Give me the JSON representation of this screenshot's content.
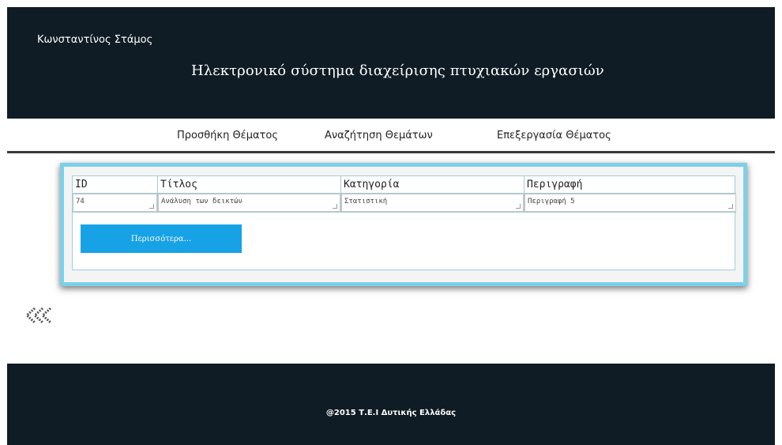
{
  "header": {
    "user_name": "Κωνσταντίνος Στάμος",
    "title": "Ηλεκτρονικό σύστημα διαχείρισης πτυχιακών εργασιών"
  },
  "nav": {
    "items": [
      {
        "label": "Προσθήκη Θέματος"
      },
      {
        "label": "Αναζήτηση Θεμάτων"
      },
      {
        "label": "Επεξεργασία Θέματος"
      }
    ]
  },
  "table": {
    "columns": [
      "ID",
      "Τίτλος",
      "Κατηγορία",
      "Περιγραφή"
    ],
    "rows": [
      {
        "id": "74",
        "title": "Ανάλυση των δεικτών",
        "category": "Στατιστική",
        "description": "Περιγραφή 5"
      }
    ]
  },
  "more_button": {
    "label": "Περισσότερα..."
  },
  "back_icon": "double-chevron-left-icon",
  "footer": {
    "copyright": "@2015 Τ.Ε.Ι Δυτικής Ελλάδας"
  },
  "colors": {
    "header_bg": "#0f1c25",
    "panel_border": "#7dd0e8",
    "button_bg": "#17a2e6"
  }
}
